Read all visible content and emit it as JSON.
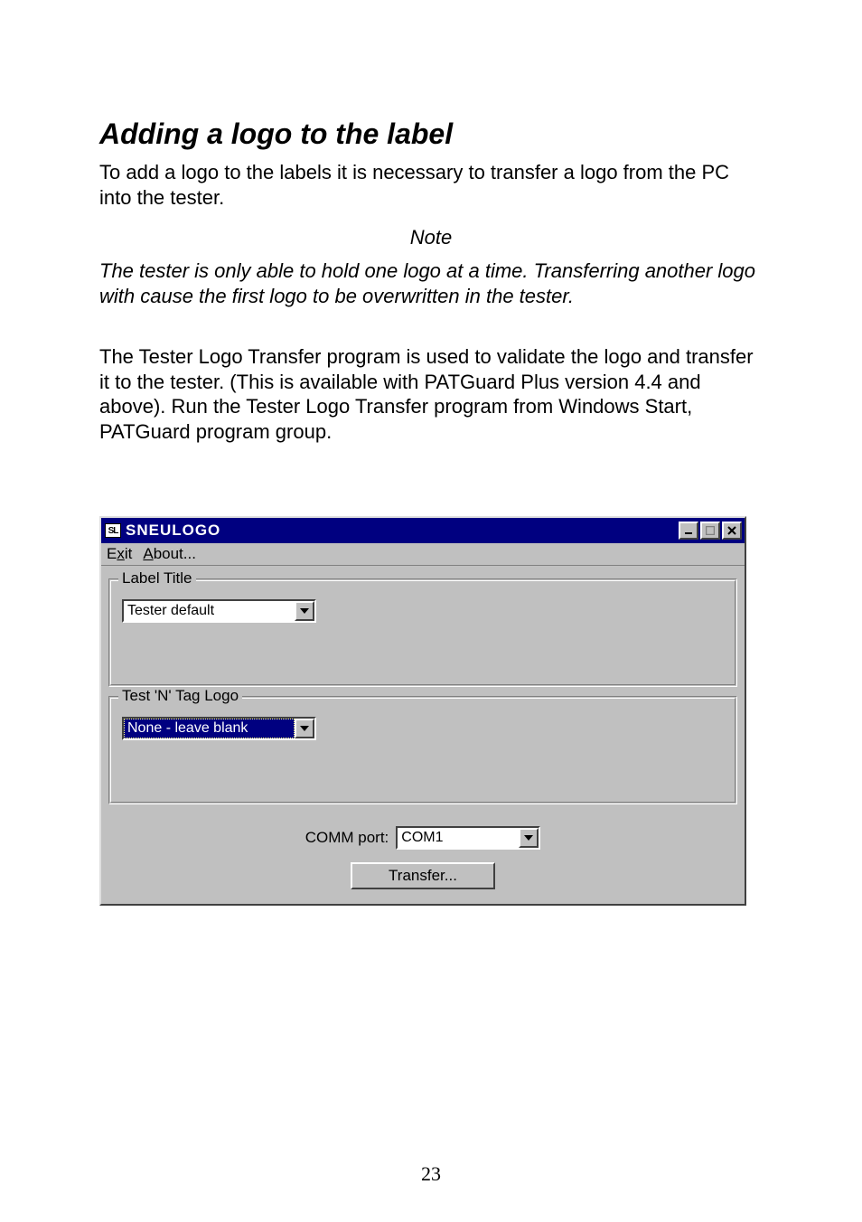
{
  "page": {
    "heading": "Adding a logo to the label",
    "intro": "To add a logo to the labels it is necessary to transfer a logo from the PC into the tester.",
    "note_label": "Note",
    "note_text": "The tester is only able to hold one logo at a time. Transferring another logo with cause the first logo to be overwritten in the tester.",
    "body2": "The Tester Logo Transfer program is used to validate the logo and transfer it to the tester. (This is available with PATGuard Plus version 4.4 and above). Run the Tester Logo Transfer program from Windows Start, PATGuard program group.",
    "page_number": "23"
  },
  "window": {
    "app_icon_text": "SL",
    "title": "SNEULOGO",
    "menu": {
      "exit_pre": "E",
      "exit_ul": "x",
      "exit_post": "it",
      "about_ul": "A",
      "about_post": "bout..."
    },
    "group_label_title": "Label Title",
    "label_title_value": "Tester default",
    "group_tag_logo": "Test 'N' Tag Logo",
    "tag_logo_value": "None - leave blank",
    "comm_label": "COMM port:",
    "comm_value": "COM1",
    "transfer_btn": "Transfer..."
  }
}
